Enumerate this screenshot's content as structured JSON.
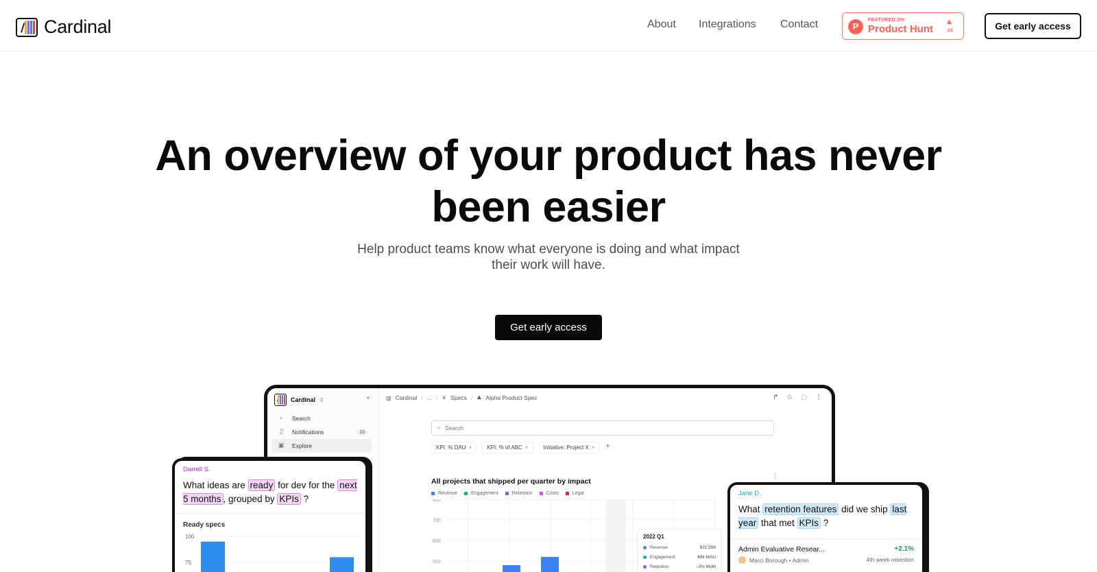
{
  "header": {
    "brand": "Cardinal",
    "nav": [
      {
        "label": "About"
      },
      {
        "label": "Integrations"
      },
      {
        "label": "Contact"
      }
    ],
    "product_hunt": {
      "featured": "FEATURED ON",
      "name": "Product Hunt",
      "count": "44",
      "icon_letter": "P"
    },
    "cta": "Get early access"
  },
  "logo_colors": [
    "#f5a623",
    "#7b61ff",
    "#3b82f6",
    "#ef4444"
  ],
  "hero": {
    "title_line1": "An overview of your product has never",
    "title_line2": "been easier",
    "subtitle": "Help product teams know what everyone is doing and what impact their work will have.",
    "cta": "Get early access"
  },
  "app": {
    "sidebar": {
      "title": "Cardinal",
      "items": [
        {
          "label": "Search",
          "icon": "search-icon"
        },
        {
          "label": "Notifications",
          "icon": "bell-icon",
          "count": "16"
        },
        {
          "label": "Explore",
          "icon": "explore-icon"
        }
      ]
    },
    "breadcrumbs": [
      "Cardinal",
      "...",
      "Specs",
      "Alpha Product Spec"
    ],
    "search": {
      "placeholder": "Search"
    },
    "filters": [
      "KPI: % DAU",
      "KPI: % of ABC",
      "Initiative: Project X"
    ],
    "chart_title": "All projects that shipped per quarter by impact",
    "legend": [
      {
        "label": "Revenue",
        "color": "#3b82f6"
      },
      {
        "label": "Engagement",
        "color": "#10b981"
      },
      {
        "label": "Retention",
        "color": "#8b5cf6"
      },
      {
        "label": "Costs",
        "color": "#d946ef"
      },
      {
        "label": "Legal",
        "color": "#e11d48"
      }
    ],
    "tooltip": {
      "title": "2022 Q1",
      "rows": [
        {
          "label": "Revenue",
          "value": "$31,598",
          "color": "#3b82f6"
        },
        {
          "label": "Engagement",
          "value": "48k MAU",
          "color": "#10b981"
        },
        {
          "label": "Retention",
          "value": "↑3% MoM",
          "color": "#8b5cf6"
        }
      ]
    }
  },
  "chart_data": [
    {
      "type": "bar",
      "title": "All projects that shipped per quarter by impact",
      "yticks": [
        800,
        700,
        600,
        500
      ],
      "ylim": [
        500,
        800
      ],
      "series": [
        {
          "name": "Revenue",
          "values": [
            480,
            520
          ]
        }
      ],
      "legend": [
        "Revenue",
        "Engagement",
        "Retention",
        "Costs",
        "Legal"
      ]
    },
    {
      "type": "bar",
      "title": "Ready specs",
      "yticks": [
        100,
        75
      ],
      "values": [
        95,
        80
      ]
    }
  ],
  "left_card": {
    "asker": "Darrell S.",
    "q": [
      "What ideas are ",
      "ready",
      " for dev for the ",
      "next 5 months",
      ",  grouped by ",
      "KPIs",
      " ?"
    ],
    "chart_title": "Ready specs"
  },
  "right_card": {
    "asker": "Jane D.",
    "q": [
      "What ",
      "retention features",
      " did we ship ",
      "last year",
      " that met ",
      "KPIs",
      " ?"
    ],
    "result": {
      "name": "Admin Evaluative Resear...",
      "delta": "+2.1%",
      "meta": "Marci Borough • Admin",
      "sub": "4th week retention"
    }
  }
}
